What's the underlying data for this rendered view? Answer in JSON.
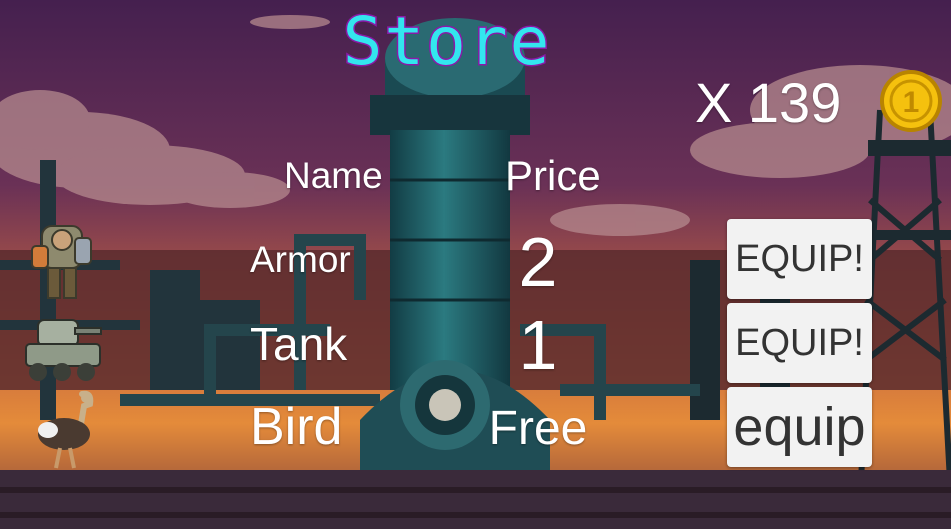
{
  "title": "Store",
  "wallet": {
    "coin_count": "X 139",
    "coin_icon": "gold-coin-icon",
    "coin_glyph": "1"
  },
  "headers": {
    "name": "Name",
    "price": "Price"
  },
  "items": [
    {
      "name": "Armor",
      "price": "2",
      "button_label": "EQUIP!",
      "sprite": "armored-soldier-sprite"
    },
    {
      "name": "Tank",
      "price": "1",
      "button_label": "EQUIP!",
      "sprite": "tank-sprite"
    },
    {
      "name": "Bird",
      "price": "Free",
      "button_label": "equip",
      "sprite": "ostrich-sprite"
    }
  ],
  "colors": {
    "title": "#33e6ee",
    "title_outline": "#8a1aa8",
    "sky_top": "#4a1e52",
    "sky_bottom": "#e08a3a",
    "tower": "#1f5f66",
    "button_bg": "#f2f2f2",
    "button_text": "#333333",
    "coin": "#f5c10e"
  }
}
